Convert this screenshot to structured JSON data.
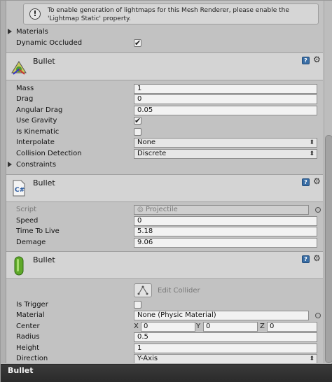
{
  "notice": {
    "icon": "info-icon",
    "text": "To enable generation of lightmaps for this Mesh Renderer, please enable the 'Lightmap Static' property."
  },
  "mesh_renderer": {
    "materials_label": "Materials",
    "dynamic_occluded_label": "Dynamic Occluded",
    "dynamic_occluded_checked": true
  },
  "rigidbody": {
    "title": "Bullet",
    "icon": "rigidbody-icon",
    "mass_label": "Mass",
    "mass": "1",
    "drag_label": "Drag",
    "drag": "0",
    "angular_drag_label": "Angular Drag",
    "angular_drag": "0.05",
    "use_gravity_label": "Use Gravity",
    "use_gravity": true,
    "is_kinematic_label": "Is Kinematic",
    "is_kinematic": false,
    "interpolate_label": "Interpolate",
    "interpolate": "None",
    "collision_detection_label": "Collision Detection",
    "collision_detection": "Discrete",
    "constraints_label": "Constraints"
  },
  "script_component": {
    "title": "Bullet",
    "icon": "csharp-script-icon",
    "script_label": "Script",
    "script_value": "Projectile",
    "speed_label": "Speed",
    "speed": "0",
    "time_to_live_label": "Time To Live",
    "time_to_live": "5.18",
    "demage_label": "Demage",
    "demage": "9.06"
  },
  "capsule_collider": {
    "title": "Bullet",
    "icon": "capsule-collider-icon",
    "edit_collider_label": "Edit Collider",
    "is_trigger_label": "Is Trigger",
    "is_trigger": false,
    "material_label": "Material",
    "material": "None (Physic Material)",
    "center_label": "Center",
    "center_x_label": "X",
    "center_x": "0",
    "center_y_label": "Y",
    "center_y": "0",
    "center_z_label": "Z",
    "center_z": "0",
    "radius_label": "Radius",
    "radius": "0.5",
    "height_label": "Height",
    "height": "1",
    "direction_label": "Direction",
    "direction": "Y-Axis"
  },
  "footer": {
    "title": "Bullet"
  },
  "colors": {
    "header_bg": "#d4d4d4",
    "panel_bg": "#c2c2c2",
    "bottom_bar": "#2f2f2f",
    "help_blue": "#3a6ea5"
  }
}
